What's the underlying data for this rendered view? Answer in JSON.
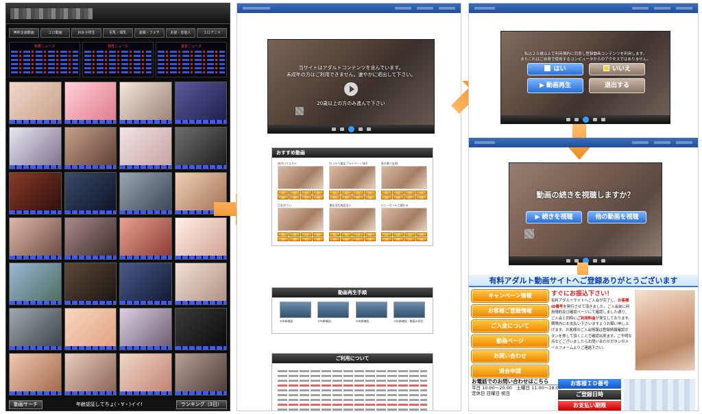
{
  "panel1": {
    "nav": [
      "無料企画動画",
      "エロ動画",
      "JK女子校生",
      "巨乳・爆乳",
      "盗撮・フェチ",
      "お姿・芸能人",
      "エロアニメ"
    ],
    "news_titles": [
      "新着ニュース",
      "相性ニュース",
      "過去ニュース"
    ],
    "footer": {
      "left": "動画サーチ",
      "middle": "年齢認証してちょ(・∀・)イイ!",
      "right": "ランキング（3日）"
    }
  },
  "panel2": {
    "player_message": [
      "当サイトはアダルトコンテンツを含んでいます。",
      "未成年の方はご利用できません。速やかに退出して下さい。"
    ],
    "player_sub": "20歳以上の方のみ進んで下さい",
    "recommended_title": "おすすめ動画",
    "recommended_items": [
      "過ぎロリエステ",
      "むっちり美女プライベートSEX",
      "過ぎ美少女J系",
      "巨乳ゆうい",
      "美乳淫乱痴女淫ら",
      "バニーガールと戯れる"
    ],
    "segment_numbers": [
      "01",
      "02",
      "03",
      "04",
      "05",
      "06",
      "07",
      "08"
    ],
    "howto_title": "動画再生手順",
    "howto_steps": [
      "①年齢確認",
      "②年齢確認",
      "③年齢確認",
      "④年齢確認・動画の再生"
    ],
    "terms_title": "ご利用について"
  },
  "panel3": {
    "age_check_text": [
      "私は２０歳以上で利用規約に同意し登録動画コンテンツを利用します。",
      "またこれはご自身で使用するコンピュータからのアクセスではありません。"
    ],
    "btn_yes": "はい",
    "btn_no": "いいえ",
    "btn_play": "動画再生",
    "btn_exit": "退出する",
    "continue_prompt": "動画の続きを視聴しますか？",
    "btn_continue": "続きを視聴",
    "btn_other": "他の動画を視聴",
    "reg_title": "有料アダルト動画サイトへご登録ありがとうございます",
    "side_menu": [
      "キャンペーン情報",
      "お客様ご登録情報",
      "ご入金について",
      "動画ページ",
      "お問い合わせ",
      "退会申請"
    ],
    "reg_highlight": "すぐにお振込下さい！",
    "reg_text_parts": [
      "有料アダルトサイトへご入会が完了し、",
      "お客様ID番号",
      "を発行させて頂きました。ご入会前に利用規約及び確認ページにて確認しました通り、ご入会と同時に",
      "ご利用料金",
      "が発生しております。期限内にお支払い下さいますようお願い申し上げます。お客様のご入会情報は登録情報確認ボタンを押して頂くことで確認出来ます。ご不明な点などございましたらお問い合わせボタンのメールフォームよりご連絡下さい。"
    ],
    "contact_title": "お電話でのお問い合わせはこちら",
    "contact_lines": [
      "平日 10:00〜20:00　土曜日 11:00〜18:00",
      "定休日 日曜日 祝日"
    ],
    "id_buttons": [
      "お客様ＩＤ番号",
      "ご登録日時",
      "お支払い期限"
    ]
  }
}
